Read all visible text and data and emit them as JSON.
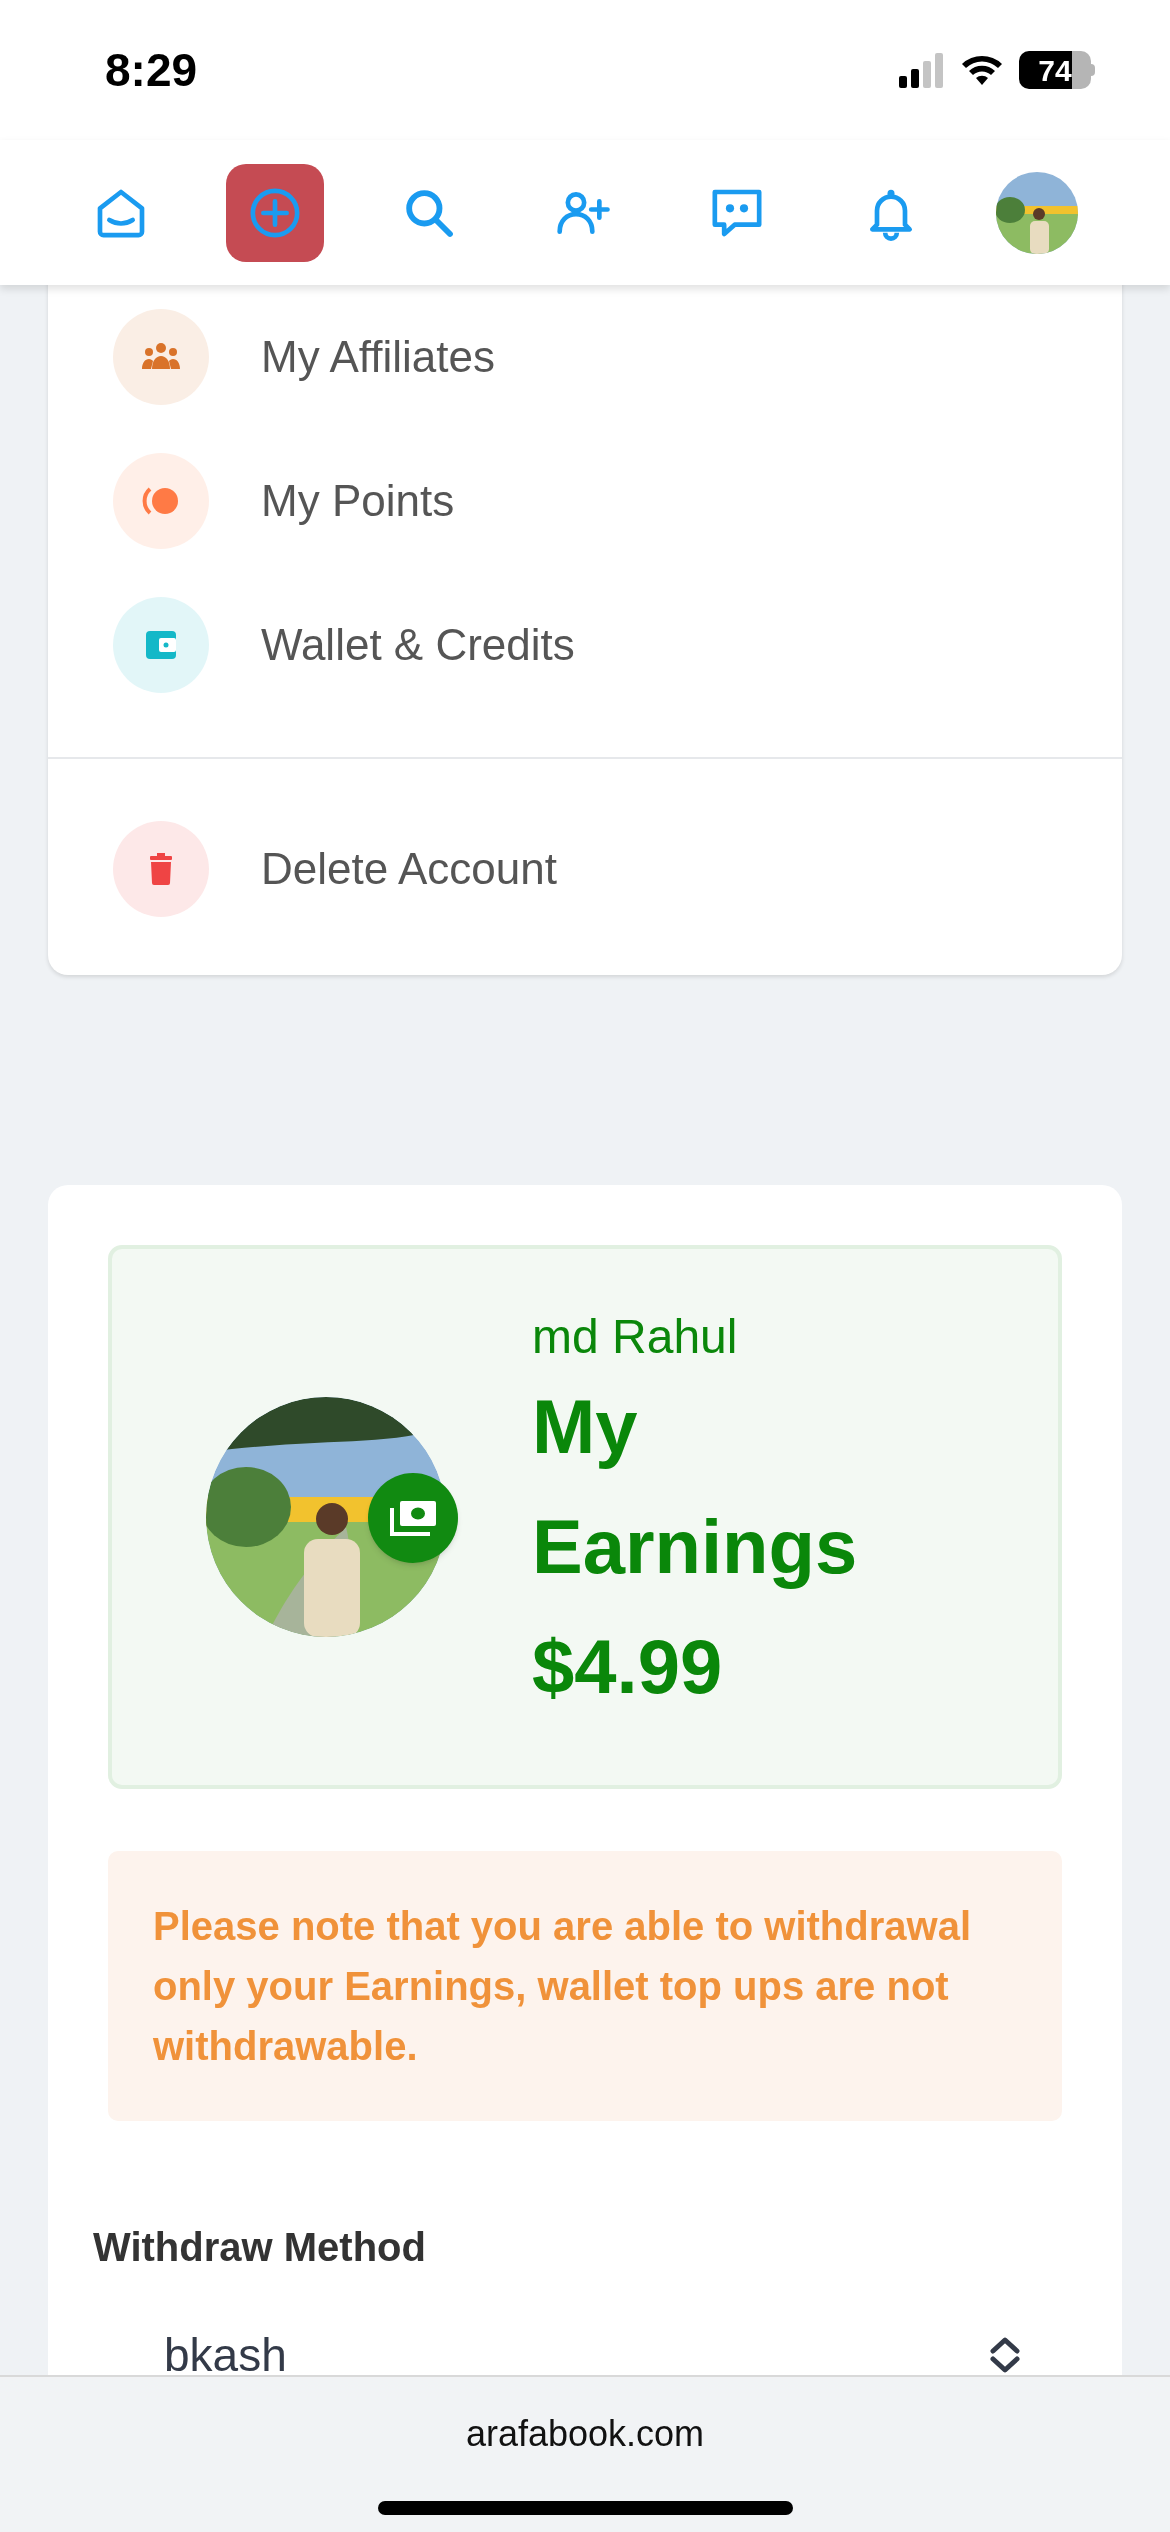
{
  "status_bar": {
    "time": "8:29",
    "battery": "74"
  },
  "nav_items": [
    {
      "selected": false
    },
    {
      "selected": true
    },
    {
      "selected": false
    },
    {
      "selected": false
    },
    {
      "selected": false
    },
    {
      "selected": false
    }
  ],
  "menu": {
    "sections": [
      [
        {
          "label": "My Affiliates",
          "color": "#d9732a"
        },
        {
          "label": "My Points",
          "color": "#ff7a45"
        },
        {
          "label": "Wallet & Credits",
          "color": "#14b8c8"
        }
      ],
      [
        {
          "label": "Delete Account",
          "color": "#ef4444"
        }
      ]
    ]
  },
  "earnings": {
    "name": "md Rahul",
    "title": "My Earnings",
    "amount": "$4.99"
  },
  "notice": "Please note that you are able to withdrawal only your Earnings, wallet top ups are not withdrawable.",
  "withdraw_method": {
    "label": "Withdraw Method",
    "value": "bkash"
  },
  "browser": {
    "url": "arafabook.com"
  }
}
